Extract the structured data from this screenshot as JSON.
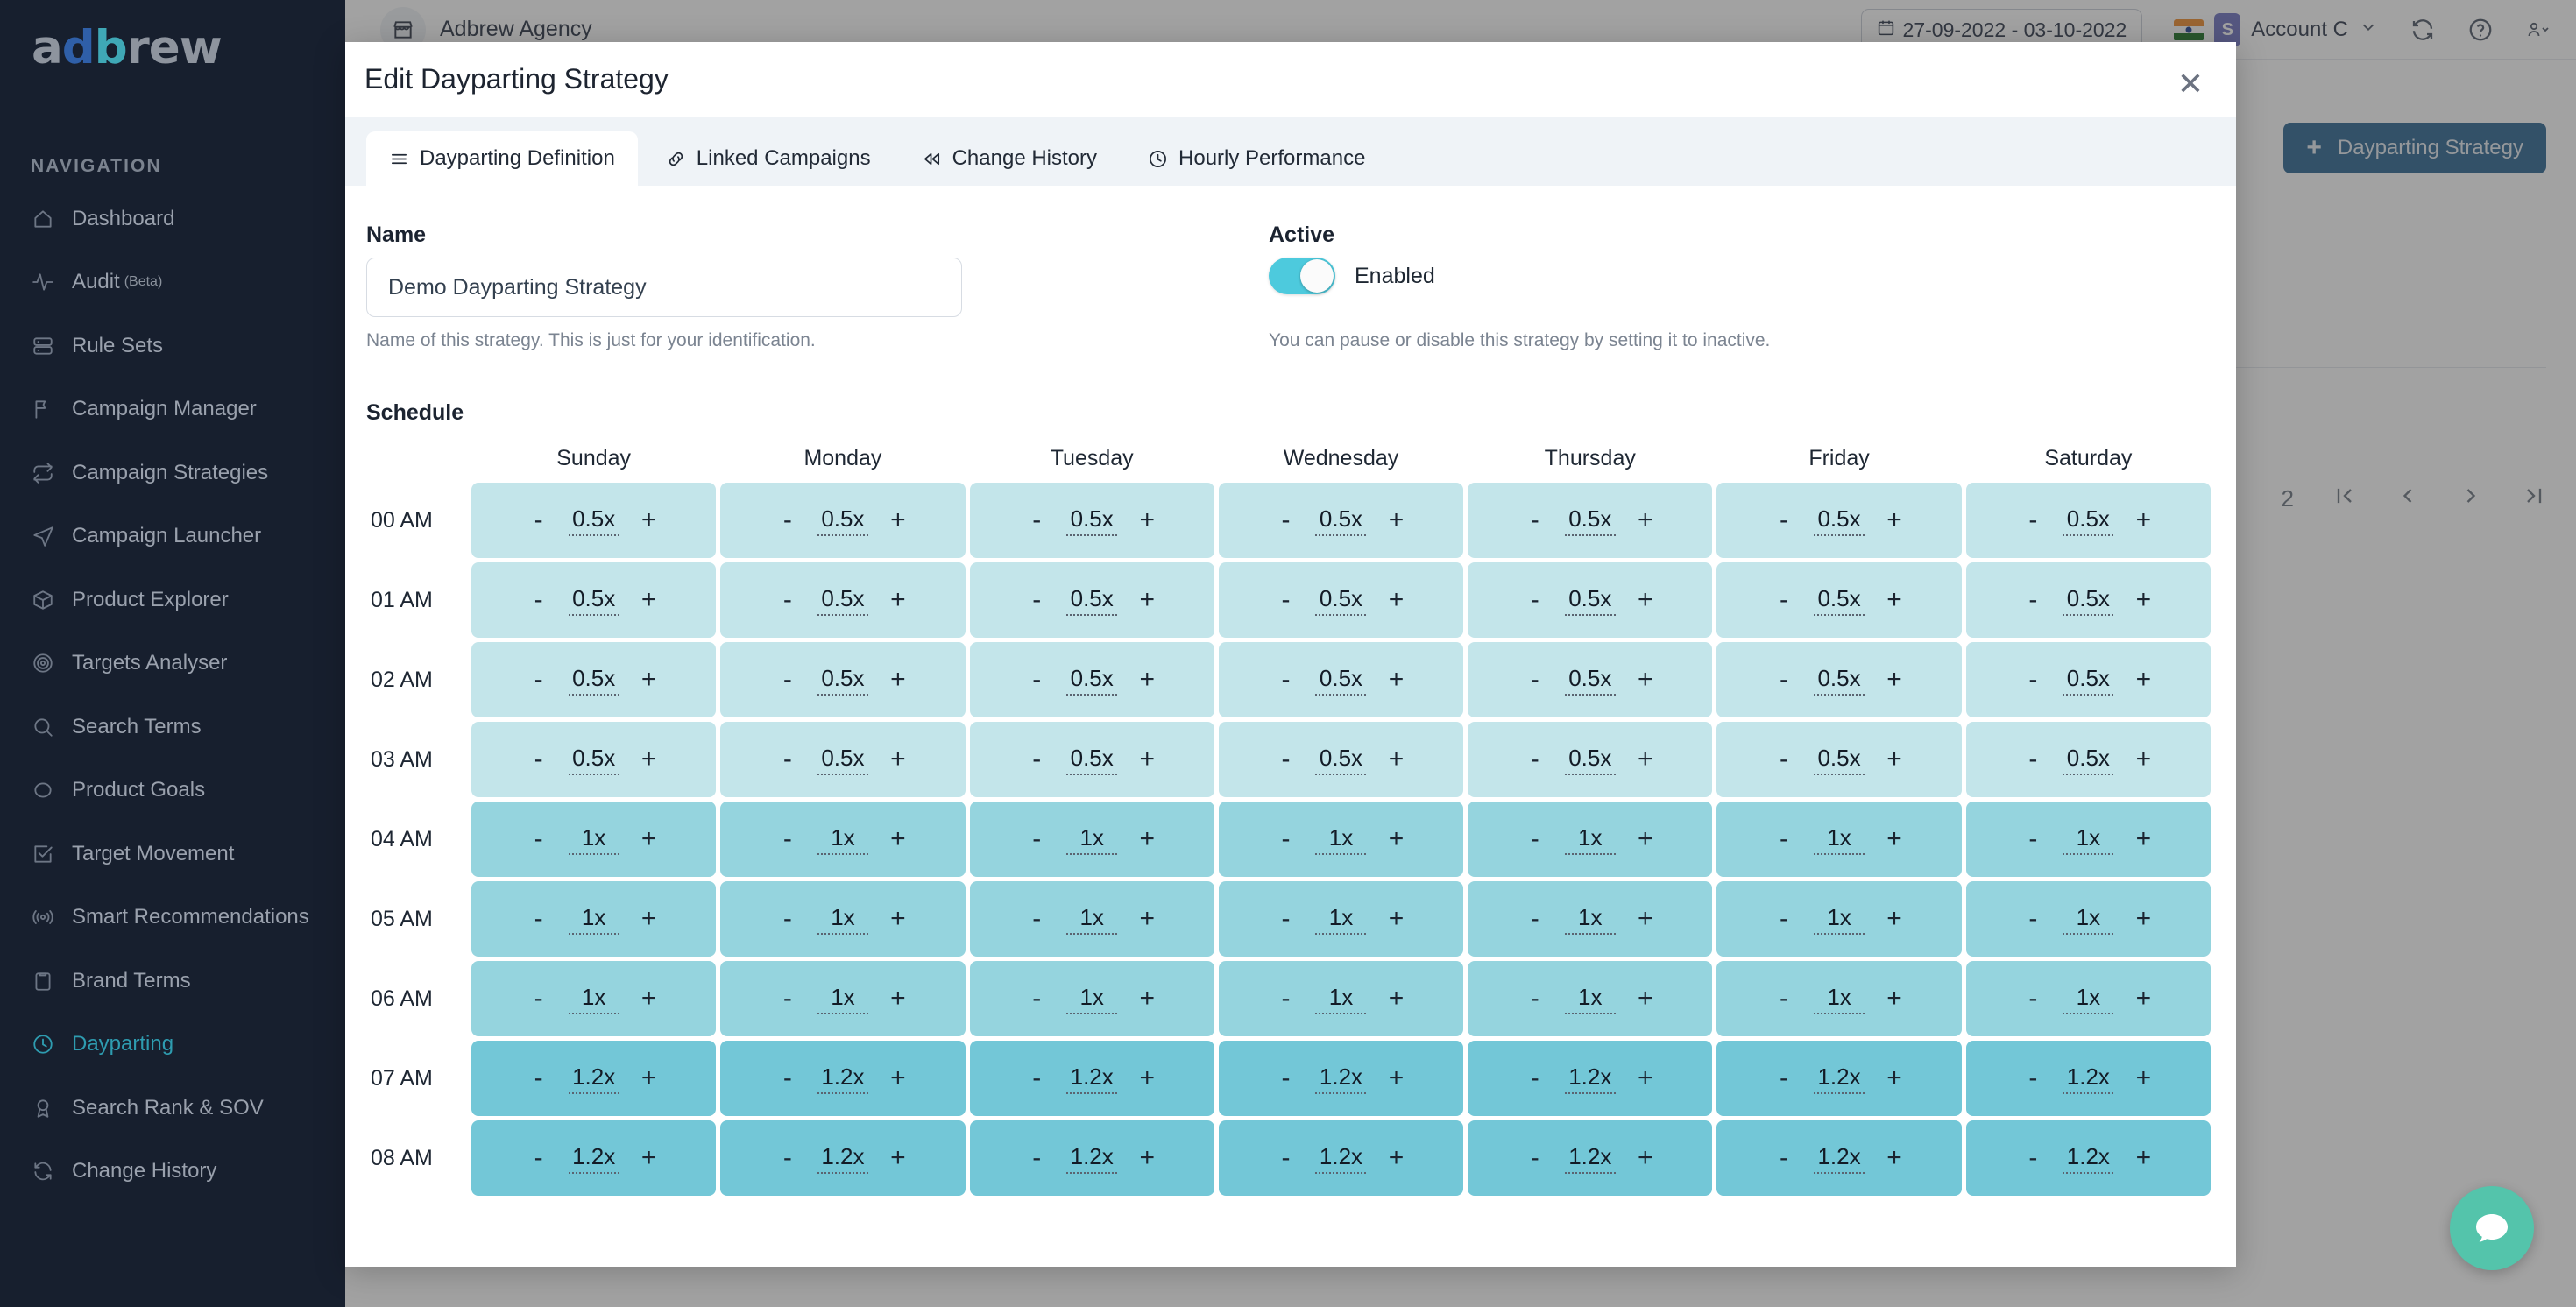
{
  "sidebar": {
    "logo": {
      "part1": "a",
      "part2": "db",
      "part3": "rew",
      "full": "adbrew"
    },
    "nav_heading": "NAVIGATION",
    "items": [
      {
        "label": "Dashboard",
        "icon": "home-icon",
        "active": false,
        "badge": ""
      },
      {
        "label": "Audit",
        "icon": "activity-icon",
        "active": false,
        "badge": "(Beta)"
      },
      {
        "label": "Rule Sets",
        "icon": "server-icon",
        "active": false,
        "badge": ""
      },
      {
        "label": "Campaign Manager",
        "icon": "flag-icon",
        "active": false,
        "badge": ""
      },
      {
        "label": "Campaign Strategies",
        "icon": "repeat-icon",
        "active": false,
        "badge": ""
      },
      {
        "label": "Campaign Launcher",
        "icon": "send-icon",
        "active": false,
        "badge": ""
      },
      {
        "label": "Product Explorer",
        "icon": "package-icon",
        "active": false,
        "badge": ""
      },
      {
        "label": "Targets Analyser",
        "icon": "target-icon",
        "active": false,
        "badge": ""
      },
      {
        "label": "Search Terms",
        "icon": "search-icon",
        "active": false,
        "badge": ""
      },
      {
        "label": "Product Goals",
        "icon": "circle-icon",
        "active": false,
        "badge": ""
      },
      {
        "label": "Target Movement",
        "icon": "check-square-icon",
        "active": false,
        "badge": ""
      },
      {
        "label": "Smart Recommendations",
        "icon": "broadcast-icon",
        "active": false,
        "badge": ""
      },
      {
        "label": "Brand Terms",
        "icon": "clipboard-icon",
        "active": false,
        "badge": ""
      },
      {
        "label": "Dayparting",
        "icon": "clock-icon",
        "active": true,
        "badge": ""
      },
      {
        "label": "Search Rank & SOV",
        "icon": "award-icon",
        "active": false,
        "badge": ""
      },
      {
        "label": "Change History",
        "icon": "refresh-icon",
        "active": false,
        "badge": ""
      }
    ]
  },
  "topbar": {
    "agency_name": "Adbrew Agency",
    "agency_icon": "store-icon",
    "date_range": "27-09-2022 - 03-10-2022",
    "date_icon": "calendar-icon",
    "flag": "in-flag",
    "account_badge": "S",
    "account_name": "Account C",
    "chevron_icon": "chevron-down-icon",
    "refresh_icon": "refresh-icon",
    "help_icon": "question-circle-icon",
    "user_icon": "user-icon"
  },
  "background": {
    "new_button_label": "Dayparting Strategy",
    "new_button_icon": "plus-icon",
    "new_button_color": "#2b6490",
    "page_number": "2",
    "pagination_icons": [
      "first-page-icon",
      "prev-page-icon",
      "next-page-icon",
      "last-page-icon"
    ]
  },
  "chat": {
    "icon": "chat-bubble-icon",
    "color": "#54c4ab"
  },
  "modal": {
    "title": "Edit Dayparting Strategy",
    "close_icon": "close-icon",
    "tabs": [
      {
        "label": "Dayparting Definition",
        "icon": "list-icon",
        "active": true
      },
      {
        "label": "Linked Campaigns",
        "icon": "link-icon",
        "active": false
      },
      {
        "label": "Change History",
        "icon": "rewind-icon",
        "active": false
      },
      {
        "label": "Hourly Performance",
        "icon": "clock-icon",
        "active": false
      }
    ],
    "name": {
      "label": "Name",
      "value": "Demo Dayparting Strategy",
      "placeholder": "Name",
      "help": "Name of this strategy. This is just for your identification."
    },
    "active": {
      "label": "Active",
      "toggle_state": "Enabled",
      "toggle_color": "#4dcadd",
      "help": "You can pause or disable this strategy by setting it to inactive."
    },
    "schedule": {
      "label": "Schedule",
      "days": [
        "Sunday",
        "Monday",
        "Tuesday",
        "Wednesday",
        "Thursday",
        "Friday",
        "Saturday"
      ],
      "hours": [
        "00 AM",
        "01 AM",
        "02 AM",
        "03 AM",
        "04 AM",
        "05 AM",
        "06 AM",
        "07 AM",
        "08 AM"
      ],
      "decrement_label": "-",
      "increment_label": "+",
      "level_colors": {
        "0.5x": "#c3e5ea",
        "1x": "#95d4de",
        "1.2x": "#73c7d7"
      },
      "values": [
        [
          "0.5x",
          "0.5x",
          "0.5x",
          "0.5x",
          "0.5x",
          "0.5x",
          "0.5x"
        ],
        [
          "0.5x",
          "0.5x",
          "0.5x",
          "0.5x",
          "0.5x",
          "0.5x",
          "0.5x"
        ],
        [
          "0.5x",
          "0.5x",
          "0.5x",
          "0.5x",
          "0.5x",
          "0.5x",
          "0.5x"
        ],
        [
          "0.5x",
          "0.5x",
          "0.5x",
          "0.5x",
          "0.5x",
          "0.5x",
          "0.5x"
        ],
        [
          "1x",
          "1x",
          "1x",
          "1x",
          "1x",
          "1x",
          "1x"
        ],
        [
          "1x",
          "1x",
          "1x",
          "1x",
          "1x",
          "1x",
          "1x"
        ],
        [
          "1x",
          "1x",
          "1x",
          "1x",
          "1x",
          "1x",
          "1x"
        ],
        [
          "1.2x",
          "1.2x",
          "1.2x",
          "1.2x",
          "1.2x",
          "1.2x",
          "1.2x"
        ],
        [
          "1.2x",
          "1.2x",
          "1.2x",
          "1.2x",
          "1.2x",
          "1.2x",
          "1.2x"
        ]
      ]
    }
  }
}
